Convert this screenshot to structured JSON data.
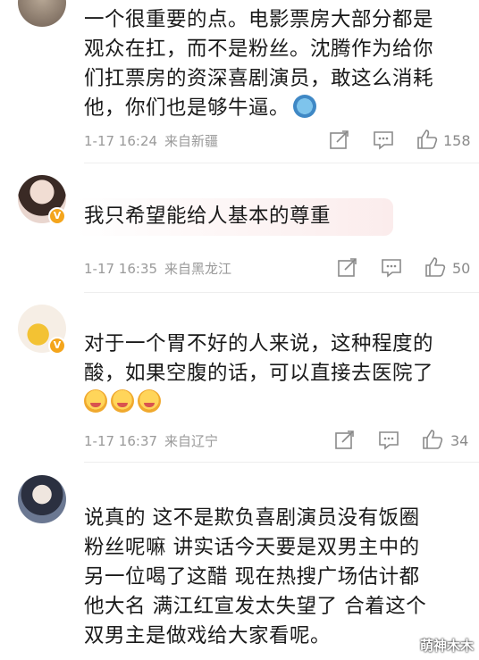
{
  "comments": [
    {
      "lines": [
        "一个很重要的点。电影票房大部分都是",
        "观众在扛，而不是粉丝。沈腾作为给你",
        "们扛票房的资深喜剧演员，敢这么消耗",
        "他，你们也是够牛逼。"
      ],
      "emoji_icons": [
        "globe-emoji-icon"
      ],
      "date": "1-17 16:24",
      "location": "来自新疆",
      "likes": "158",
      "verified": false
    },
    {
      "lines": [
        "我只希望能给人基本的尊重"
      ],
      "emoji_icons": [],
      "date": "1-17 16:35",
      "location": "来自黑龙江",
      "likes": "50",
      "verified": true
    },
    {
      "lines": [
        "对于一个胃不好的人来说，这种程度的",
        "酸，如果空腹的话，可以直接去医院了"
      ],
      "emoji_icons": [
        "smile-emoji-icon",
        "smile-emoji-icon",
        "smile-emoji-icon"
      ],
      "date": "1-17 16:37",
      "location": "来自辽宁",
      "likes": "34",
      "verified": true
    },
    {
      "lines": [
        "说真的 这不是欺负喜剧演员没有饭圈",
        "粉丝呢嘛 讲实话今天要是双男主中的",
        "另一位喝了这醋 现在热搜广场估计都",
        "他大名 满江红宣发太失望了 合着这个",
        "双男主是做戏给大家看呢。"
      ],
      "emoji_icons": [],
      "verified": false
    }
  ],
  "verified_badge": "V",
  "watermark": "萌神木木",
  "colors": {
    "meta": "#9a9a9a",
    "badge": "#f4a51c",
    "icon": "#8a8a8a"
  },
  "action_icons": [
    "share-icon",
    "comment-icon",
    "like-icon"
  ]
}
